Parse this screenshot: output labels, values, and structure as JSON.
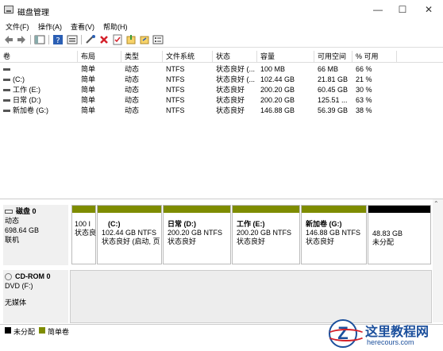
{
  "window": {
    "title": "磁盘管理",
    "minimize": "—",
    "maximize": "☐",
    "close": "✕"
  },
  "menu": [
    "文件(F)",
    "操作(A)",
    "查看(V)",
    "帮助(H)"
  ],
  "toolbar_icons": [
    "back-arrow-icon",
    "forward-arrow-icon",
    "console-tree-icon",
    "help-icon",
    "properties-icon",
    "connect-icon",
    "delete-icon",
    "check-icon",
    "refresh-icon",
    "export-icon",
    "list-view-icon"
  ],
  "colors": {
    "primary": "#7e8c00",
    "primary_top": "#7e7e00",
    "unallocated": "#000000",
    "cd_area": "#ededed",
    "logo_blue": "#1b4f9c",
    "logo_red": "#d4202a"
  },
  "columns": [
    "卷",
    "布局",
    "类型",
    "文件系统",
    "状态",
    "容量",
    "可用空间",
    "% 可用"
  ],
  "volumes": [
    {
      "name": "",
      "layout": "简单",
      "type": "动态",
      "fs": "NTFS",
      "status": "状态良好 (...",
      "capacity": "100 MB",
      "free": "66 MB",
      "pct": "66 %"
    },
    {
      "name": "(C:)",
      "layout": "简单",
      "type": "动态",
      "fs": "NTFS",
      "status": "状态良好 (...",
      "capacity": "102.44 GB",
      "free": "21.81 GB",
      "pct": "21 %"
    },
    {
      "name": "工作 (E:)",
      "layout": "简单",
      "type": "动态",
      "fs": "NTFS",
      "status": "状态良好",
      "capacity": "200.20 GB",
      "free": "60.45 GB",
      "pct": "30 %"
    },
    {
      "name": "日常 (D:)",
      "layout": "简单",
      "type": "动态",
      "fs": "NTFS",
      "status": "状态良好",
      "capacity": "200.20 GB",
      "free": "125.51 ...",
      "pct": "63 %"
    },
    {
      "name": "新加卷 (G:)",
      "layout": "简单",
      "type": "动态",
      "fs": "NTFS",
      "status": "状态良好",
      "capacity": "146.88 GB",
      "free": "56.39 GB",
      "pct": "38 %"
    }
  ],
  "disk0": {
    "name": "磁盘 0",
    "type": "动态",
    "size": "698.64 GB",
    "status": "联机",
    "partitions": [
      {
        "title": "",
        "line1": "100 I",
        "line2": "状态良"
      },
      {
        "title": "(C:)",
        "line1": "102.44 GB NTFS",
        "line2": "状态良好 (启动, 页"
      },
      {
        "title": "日常  (D:)",
        "line1": "200.20 GB NTFS",
        "line2": "状态良好"
      },
      {
        "title": "工作  (E:)",
        "line1": "200.20 GB NTFS",
        "line2": "状态良好"
      },
      {
        "title": "新加卷  (G:)",
        "line1": "146.88 GB NTFS",
        "line2": "状态良好"
      },
      {
        "title": "",
        "line1": "48.83 GB",
        "line2": "未分配"
      }
    ]
  },
  "cdrom": {
    "name": "CD-ROM 0",
    "drive": "DVD (F:)",
    "media": "无媒体"
  },
  "legend": [
    "未分配",
    "简单卷"
  ],
  "watermark": {
    "name": "这里教程网",
    "url": "herecours.com"
  }
}
